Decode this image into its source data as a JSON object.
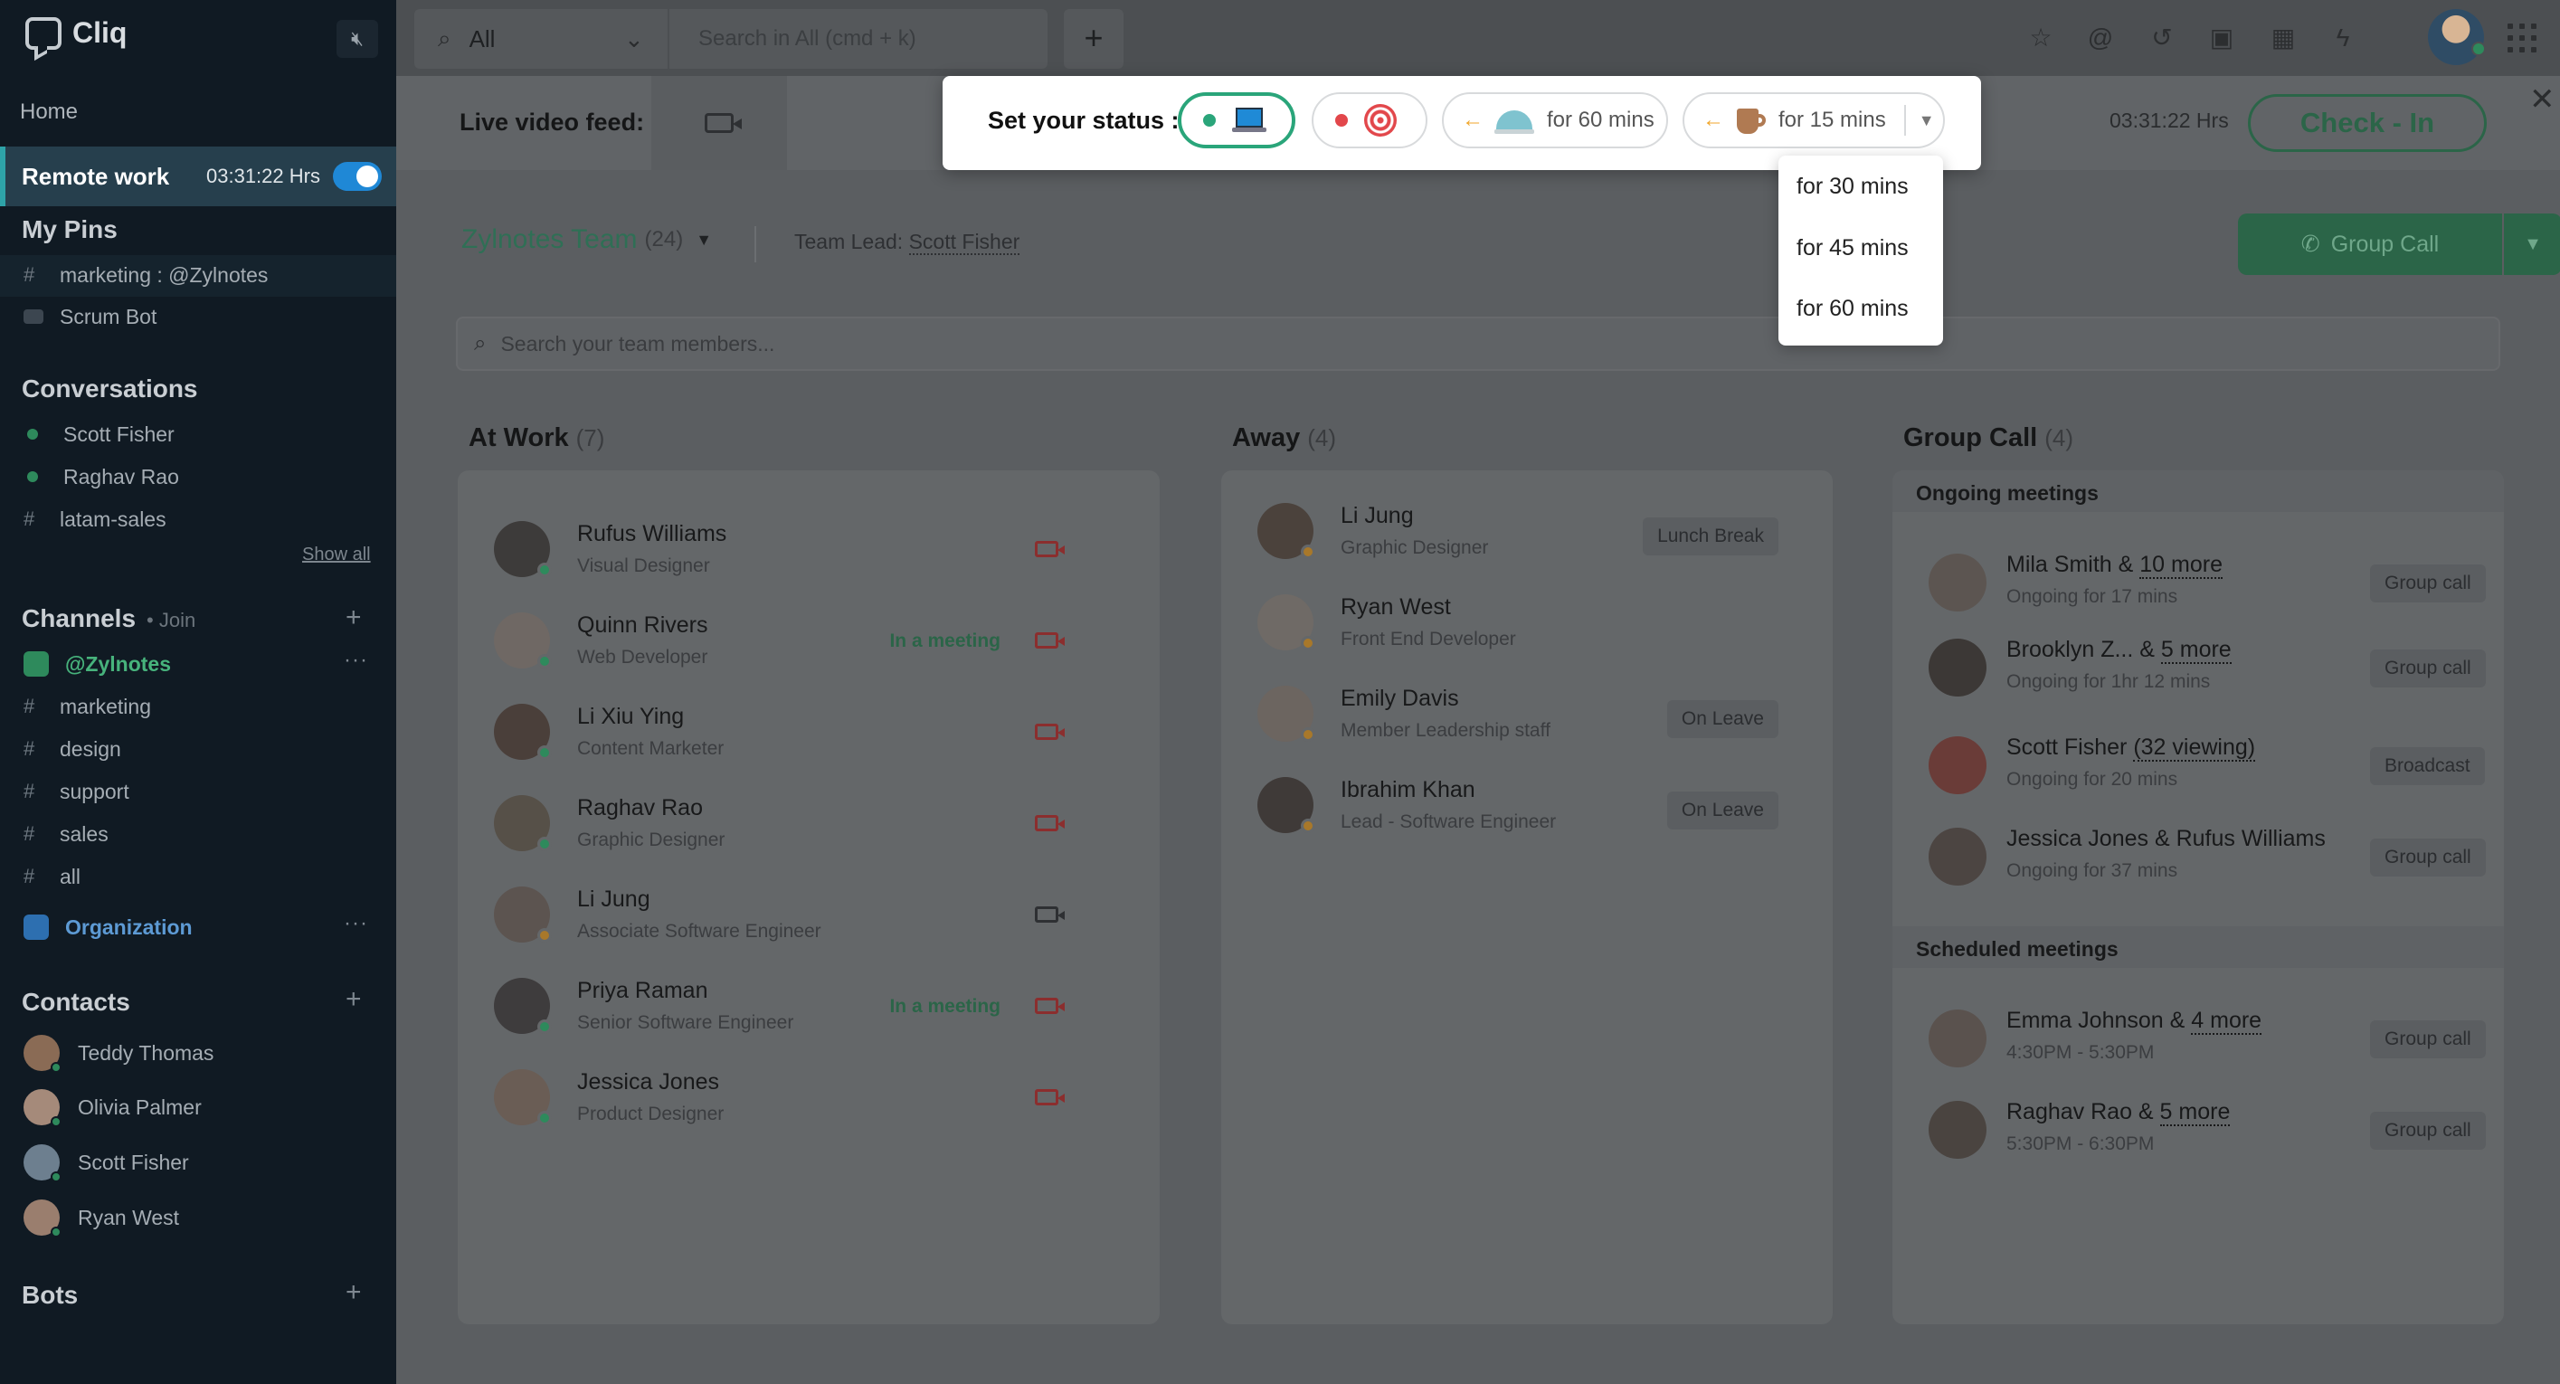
{
  "app": {
    "name": "Cliq"
  },
  "sidebar": {
    "home": "Home",
    "remote_work": {
      "label": "Remote work",
      "time": "03:31:22 Hrs"
    },
    "pins": {
      "title": "My Pins",
      "items": [
        {
          "prefix": "#",
          "label": "marketing : @Zylnotes"
        },
        {
          "label": "Scrum Bot"
        }
      ]
    },
    "conversations": {
      "title": "Conversations",
      "items": [
        {
          "label": "Scott Fisher"
        },
        {
          "label": "Raghav Rao"
        },
        {
          "prefix": "#",
          "label": "latam-sales"
        }
      ],
      "show_all": "Show all"
    },
    "channels": {
      "title": "Channels",
      "join": "• Join",
      "plus": "+",
      "group": "@Zylnotes",
      "items": [
        "marketing",
        "design",
        "support",
        "sales",
        "all"
      ],
      "org": "Organization",
      "ellipsis": "···"
    },
    "contacts": {
      "title": "Contacts",
      "plus": "+",
      "items": [
        "Teddy Thomas",
        "Olivia Palmer",
        "Scott Fisher",
        "Ryan West"
      ]
    },
    "bots": {
      "title": "Bots",
      "plus": "+"
    }
  },
  "topbar": {
    "scope": "All",
    "search_placeholder": "Search in All (cmd + k)",
    "plus": "+",
    "icons": [
      "star-icon",
      "mention-icon",
      "history-icon",
      "clipboard-icon",
      "calendar-icon",
      "plug-icon",
      "apps-grid-icon"
    ]
  },
  "feed": {
    "label": "Live video feed:",
    "time": "03:31:22 Hrs",
    "checkin": "Check - In",
    "close": "✕"
  },
  "team": {
    "name": "Zylnotes Team",
    "count": "(24)",
    "lead_label": "Team Lead:",
    "lead_name": "Scott Fisher",
    "search_placeholder": "Search your team members...",
    "group_call": "Group Call"
  },
  "columns": {
    "at_work": {
      "title": "At Work",
      "count": "(7)",
      "members": [
        {
          "name": "Rufus Williams",
          "role": "Visual Designer",
          "meeting": "",
          "video": "on"
        },
        {
          "name": "Quinn Rivers",
          "role": "Web Developer",
          "meeting": "In a meeting",
          "video": "on"
        },
        {
          "name": "Li Xiu Ying",
          "role": "Content Marketer",
          "meeting": "",
          "video": "on"
        },
        {
          "name": "Raghav Rao",
          "role": "Graphic Designer",
          "meeting": "",
          "video": "on"
        },
        {
          "name": "Li Jung",
          "role": "Associate Software Engineer",
          "meeting": "",
          "video": "off"
        },
        {
          "name": "Priya Raman",
          "role": "Senior Software Engineer",
          "meeting": "In a meeting",
          "video": "on"
        },
        {
          "name": "Jessica Jones",
          "role": "Product Designer",
          "meeting": "",
          "video": "on"
        }
      ]
    },
    "away": {
      "title": "Away",
      "count": "(4)",
      "members": [
        {
          "name": "Li Jung",
          "role": "Graphic Designer",
          "badge": "Lunch Break"
        },
        {
          "name": "Ryan West",
          "role": "Front End Developer",
          "badge": ""
        },
        {
          "name": "Emily Davis",
          "role": "Member Leadership staff",
          "badge": "On Leave"
        },
        {
          "name": "Ibrahim Khan",
          "role": "Lead - Software Engineer",
          "badge": "On Leave"
        }
      ]
    },
    "group_call": {
      "title": "Group Call",
      "count": "(4)",
      "ongoing_title": "Ongoing meetings",
      "ongoing": [
        {
          "name": "Mila Smith & ",
          "more": "10 more",
          "sub": "Ongoing for 17 mins",
          "action": "Group call"
        },
        {
          "name": "Brooklyn Z... & ",
          "more": "5 more",
          "sub": "Ongoing for 1hr 12 mins",
          "action": "Group call"
        },
        {
          "name": "Scott Fisher ",
          "more": "(32 viewing)",
          "sub": "Ongoing for 20 mins",
          "action": "Broadcast"
        },
        {
          "name": "Jessica Jones & Rufus Williams",
          "more": "",
          "sub": "Ongoing for 37 mins",
          "action": "Group call"
        }
      ],
      "scheduled_title": "Scheduled meetings",
      "scheduled": [
        {
          "name": "Emma Johnson & ",
          "more": "4 more",
          "sub": "4:30PM - 5:30PM",
          "action": "Group call"
        },
        {
          "name": "Raghav Rao & ",
          "more": "5 more",
          "sub": "5:30PM - 6:30PM",
          "action": "Group call"
        }
      ]
    }
  },
  "status_popup": {
    "label": "Set your status :",
    "chip_lunch": "for 60 mins",
    "chip_coffee": "for 15 mins",
    "dropdown": [
      "for 30 mins",
      "for 45 mins",
      "for 60 mins"
    ]
  },
  "colors": {
    "accent_green": "#2aa57a",
    "sidebar_bg": "#101a23",
    "remote_highlight": "#263f4d",
    "toggle_blue": "#1f88d6",
    "busy_red": "#e2474b"
  }
}
